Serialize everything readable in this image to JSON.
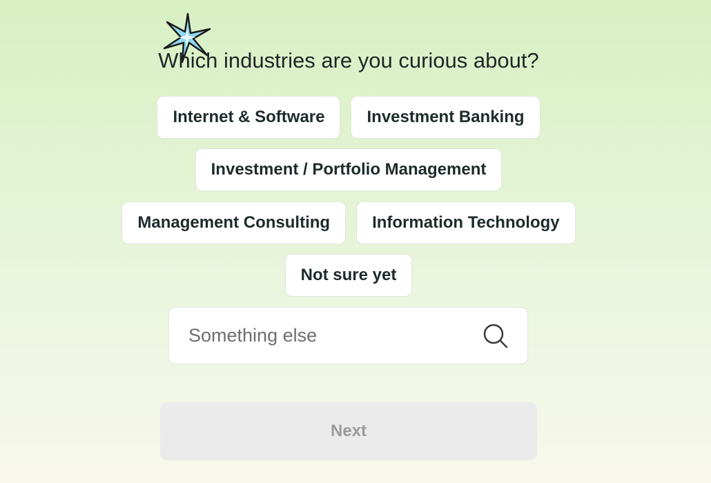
{
  "question": "Which industries are you curious about?",
  "options_row1": [
    "Internet & Software",
    "Investment Banking"
  ],
  "options_row2": [
    "Investment / Portfolio Management"
  ],
  "options_row3": [
    "Management Consulting",
    "Information Technology"
  ],
  "options_row4": [
    "Not sure yet"
  ],
  "search": {
    "placeholder": "Something else",
    "value": ""
  },
  "next_label": "Next",
  "icons": {
    "decoration": "sparkle-icon",
    "search": "search-icon"
  },
  "colors": {
    "background_top": "#d8f0c4",
    "background_bottom": "#f8f8ec",
    "chip_bg": "#ffffff",
    "next_bg_disabled": "#ebebeb",
    "next_text_disabled": "#9a9a9a",
    "sparkle_fill": "#8fd8f2"
  }
}
